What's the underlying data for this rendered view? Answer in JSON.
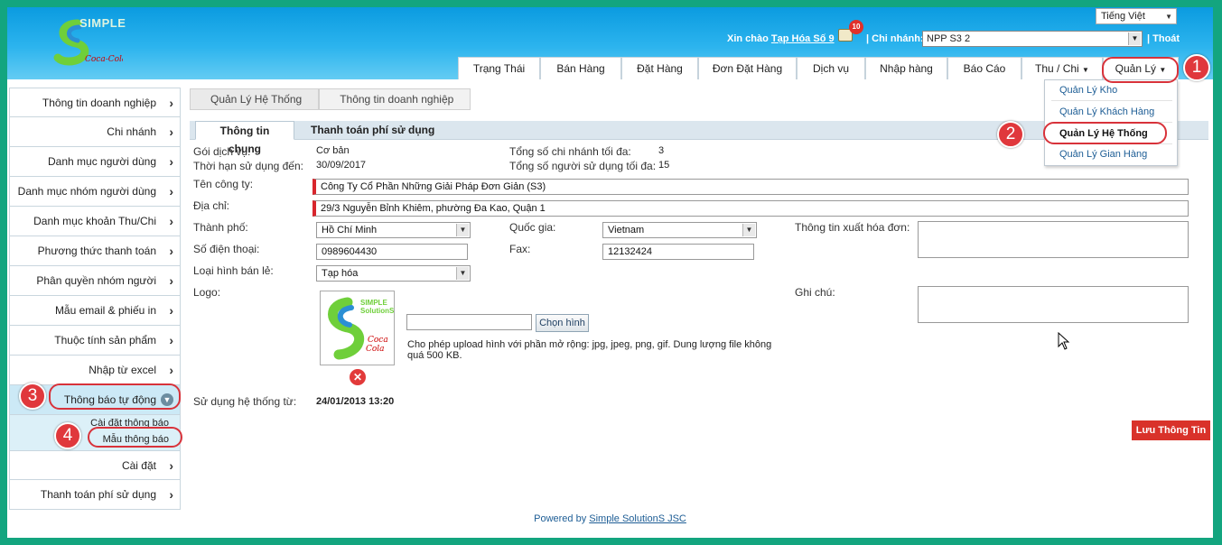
{
  "header": {
    "logo_text": "SIMPLE",
    "language": "Tiếng Việt",
    "greeting_prefix": "Xin chào",
    "user_name": "Tạp Hóa Số 9",
    "notification_count": "10",
    "branch_label": "Chi nhánh:",
    "branch_value": "NPP S3 2",
    "logout": "Thoát"
  },
  "nav": [
    {
      "label": "Trạng Thái"
    },
    {
      "label": "Bán Hàng"
    },
    {
      "label": "Đặt Hàng"
    },
    {
      "label": "Đơn Đặt Hàng"
    },
    {
      "label": "Dịch vụ"
    },
    {
      "label": "Nhập hàng"
    },
    {
      "label": "Báo Cáo"
    },
    {
      "label": "Thu / Chi"
    },
    {
      "label": "Quản Lý"
    }
  ],
  "dropdown": [
    {
      "label": "Quản Lý Kho"
    },
    {
      "label": "Quản Lý Khách Hàng"
    },
    {
      "label": "Quản Lý Hệ Thống"
    },
    {
      "label": "Quản Lý Gian Hàng"
    }
  ],
  "sidebar": {
    "items": [
      {
        "label": "Thông tin doanh nghiệp"
      },
      {
        "label": "Chi nhánh"
      },
      {
        "label": "Danh mục người dùng"
      },
      {
        "label": "Danh mục nhóm người dùng"
      },
      {
        "label": "Danh mục khoản Thu/Chi"
      },
      {
        "label": "Phương thức thanh toán"
      },
      {
        "label": "Phân quyền nhóm người dùng"
      },
      {
        "label": "Mẫu email & phiếu in"
      },
      {
        "label": "Thuộc tính sản phẩm"
      },
      {
        "label": "Nhập từ excel"
      },
      {
        "label": "Thông báo tự động"
      },
      {
        "label": "Cài đặt"
      },
      {
        "label": "Thanh toán phí sử dụng"
      }
    ],
    "sub_items": [
      {
        "label": "Cài đặt thông báo"
      },
      {
        "label": "Mẫu thông báo"
      }
    ]
  },
  "breadcrumb": [
    "Quản Lý Hệ Thống",
    "Thông tin doanh nghiệp"
  ],
  "tabs": [
    "Thông tin chung",
    "Thanh toán phí sử dụng"
  ],
  "form": {
    "service_package_label": "Gói dịch vụ:",
    "service_package_value": "Cơ bản",
    "expiry_label": "Thời hạn sử dụng đến:",
    "expiry_value": "30/09/2017",
    "max_branches_label": "Tổng số chi nhánh tối đa:",
    "max_branches_value": "3",
    "max_users_label": "Tổng số người sử dụng tối đa:",
    "max_users_value": "15",
    "company_label": "Tên công ty:",
    "company_value": "Công Ty Cổ Phần Những Giải Pháp Đơn Giản (S3)",
    "address_label": "Địa chỉ:",
    "address_value": "29/3 Nguyễn Bỉnh Khiêm, phường Đa Kao, Quận 1",
    "city_label": "Thành phố:",
    "city_value": "Hồ Chí Minh",
    "country_label": "Quốc gia:",
    "country_value": "Vietnam",
    "invoice_label": "Thông tin xuất hóa đơn:",
    "phone_label": "Số điện thoại:",
    "phone_value": "0989604430",
    "fax_label": "Fax:",
    "fax_value": "12132424",
    "retail_type_label": "Loại hình bán lẻ:",
    "retail_type_value": "Tạp hóa",
    "logo_label": "Logo:",
    "note_label": "Ghi chú:",
    "choose_image": "Chọn hình",
    "upload_note": "Cho phép upload hình với phần mở rộng: jpg, jpeg, png, gif. Dung lượng file không quá 500 KB.",
    "since_label": "Sử dụng hệ thống từ:",
    "since_value": "24/01/2013 13:20",
    "save_button": "Lưu Thông Tin"
  },
  "logo_box_text": "SIMPLE SolutionS",
  "annotations": [
    "1",
    "2",
    "3",
    "4"
  ],
  "footer": {
    "prefix": "Powered by",
    "link": "Simple SolutionS JSC"
  },
  "colors": {
    "frame": "#13a57f",
    "header_top": "#0b9be0",
    "accent_red": "#d9322a",
    "link_blue": "#1d5d95"
  }
}
